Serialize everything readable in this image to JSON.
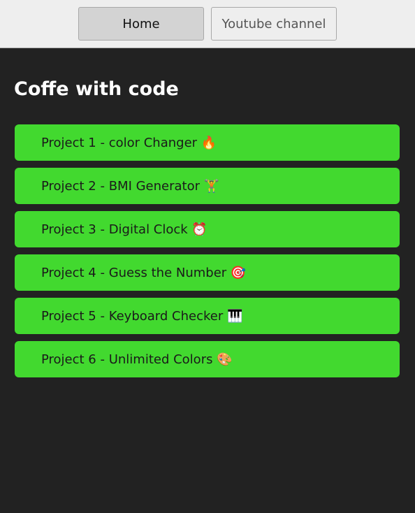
{
  "nav": {
    "home": "Home",
    "youtube": "Youtube channel"
  },
  "title": "Coffe with code",
  "projects": [
    {
      "label": "Project 1 - color Changer 🔥"
    },
    {
      "label": "Project 2 - BMI Generator 🏋️"
    },
    {
      "label": "Project 3 - Digital Clock ⏰"
    },
    {
      "label": "Project 4 - Guess the Number 🎯"
    },
    {
      "label": "Project 5 - Keyboard Checker 🎹"
    },
    {
      "label": "Project 6 - Unlimited Colors 🎨"
    }
  ],
  "colors": {
    "accent": "#42d92f",
    "background": "#222222"
  }
}
